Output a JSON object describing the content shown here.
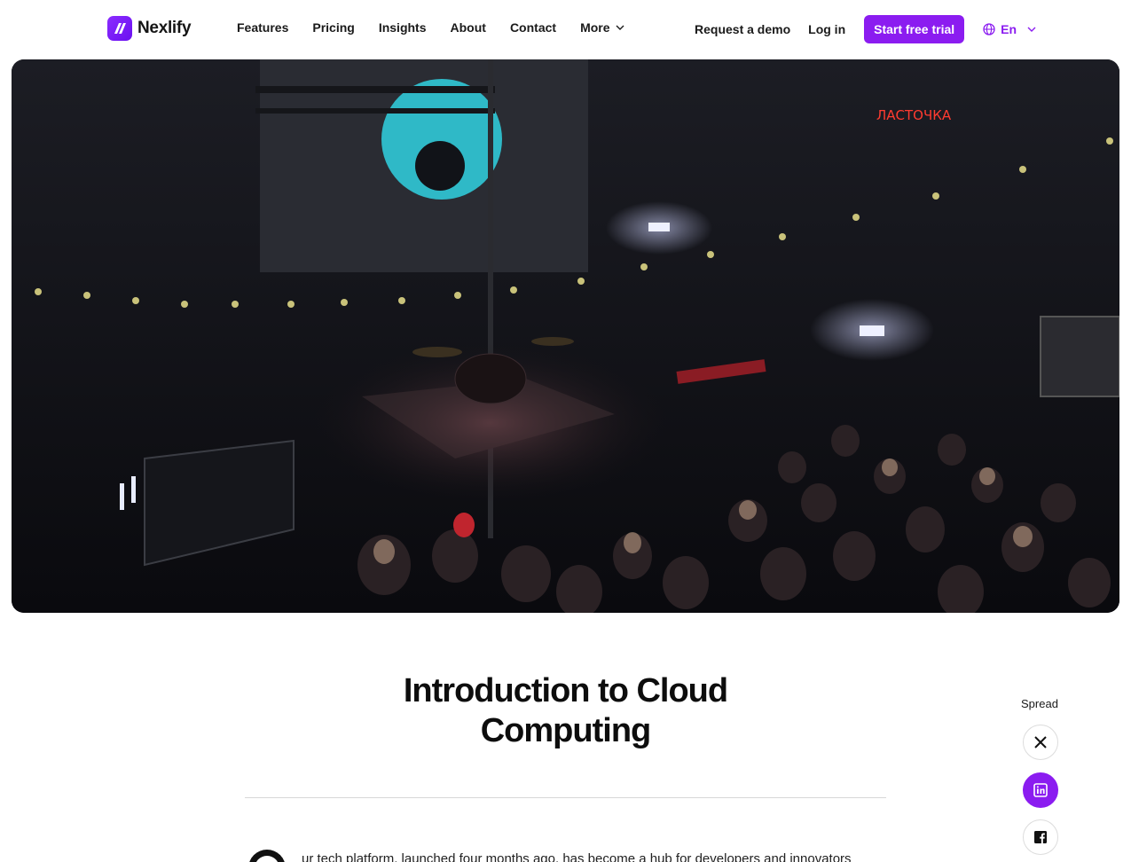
{
  "brand": {
    "name": "Nexlify",
    "accent": "#8b1cf0"
  },
  "nav": {
    "items": [
      {
        "label": "Features"
      },
      {
        "label": "Pricing"
      },
      {
        "label": "Insights"
      },
      {
        "label": "About"
      },
      {
        "label": "Contact"
      },
      {
        "label": "More",
        "icon": "chevron-down-icon"
      }
    ]
  },
  "actions": {
    "demo_label": "Request a demo",
    "login_label": "Log in",
    "trial_label": "Start free trial",
    "language": "En"
  },
  "hero": {
    "neon_sign": "ЛАСТОЧКА"
  },
  "article": {
    "title_line1": "Introduction to Cloud",
    "title_line2": "Computing",
    "intro": "ur tech platform, launched four months ago, has become a hub for developers and innovators"
  },
  "share": {
    "label": "Spread",
    "buttons": [
      {
        "icon": "x-twitter-icon"
      },
      {
        "icon": "linkedin-icon",
        "active": true
      },
      {
        "icon": "facebook-icon"
      }
    ]
  }
}
